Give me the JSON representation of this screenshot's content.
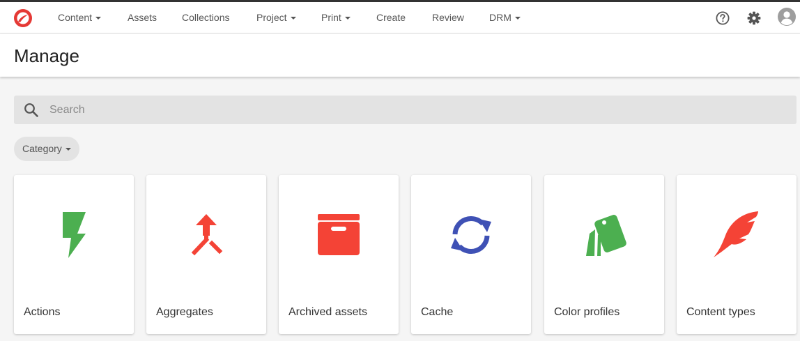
{
  "nav": {
    "items": [
      {
        "label": "Content",
        "dropdown": true
      },
      {
        "label": "Assets",
        "dropdown": false
      },
      {
        "label": "Collections",
        "dropdown": false
      },
      {
        "label": "Project",
        "dropdown": true
      },
      {
        "label": "Print",
        "dropdown": true
      },
      {
        "label": "Create",
        "dropdown": false
      },
      {
        "label": "Review",
        "dropdown": false
      },
      {
        "label": "DRM",
        "dropdown": true
      }
    ],
    "icons": [
      "help-icon",
      "settings-icon",
      "avatar-icon"
    ]
  },
  "header": {
    "title": "Manage"
  },
  "search": {
    "placeholder": "Search",
    "value": ""
  },
  "filter": {
    "label": "Category"
  },
  "cards": [
    {
      "label": "Actions",
      "icon": "lightning-icon",
      "color": "#4caf50"
    },
    {
      "label": "Aggregates",
      "icon": "merge-icon",
      "color": "#f44336"
    },
    {
      "label": "Archived assets",
      "icon": "archive-icon",
      "color": "#f44336"
    },
    {
      "label": "Cache",
      "icon": "sync-icon",
      "color": "#3f51b5"
    },
    {
      "label": "Color profiles",
      "icon": "swatch-icon",
      "color": "#4caf50"
    },
    {
      "label": "Content types",
      "icon": "feather-icon",
      "color": "#f44336"
    }
  ],
  "colors": {
    "brand": "#e53935",
    "accent_green": "#4caf50",
    "accent_red": "#f44336",
    "accent_blue": "#3f51b5"
  }
}
